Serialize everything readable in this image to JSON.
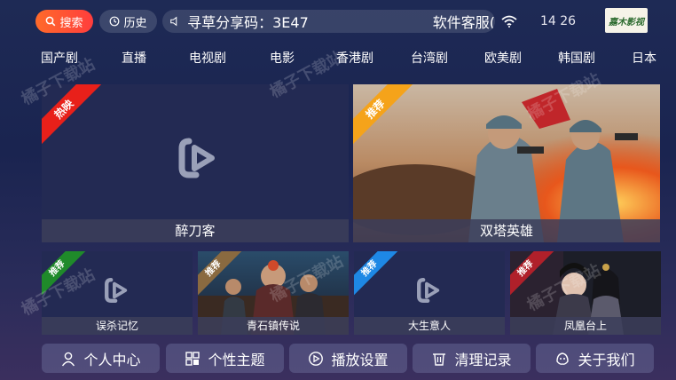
{
  "topbar": {
    "search_label": "搜索",
    "history_label": "历史",
    "marquee_text_1": "寻草分享码：3E47",
    "marquee_text_2": "软件客服(",
    "time": "14 26",
    "logo_text": "嘉木影视"
  },
  "nav": {
    "items": [
      "国产剧",
      "直播",
      "电视剧",
      "电影",
      "香港剧",
      "台湾剧",
      "欧美剧",
      "韩国剧",
      "日本"
    ]
  },
  "cards": {
    "big": [
      {
        "title": "醉刀客",
        "badge": "热映",
        "badge_color": "#e8201a"
      },
      {
        "title": "双塔英雄",
        "badge": "推荐",
        "badge_color": "#f5a31a"
      }
    ],
    "small": [
      {
        "title": "误杀记忆",
        "badge": "推荐",
        "badge_color": "#1f8a2a"
      },
      {
        "title": "青石镇传说",
        "badge": "推荐",
        "badge_color": "#8a6a40"
      },
      {
        "title": "大生意人",
        "badge": "推荐",
        "badge_color": "#1e88e5"
      },
      {
        "title": "凤凰台上",
        "badge": "推荐",
        "badge_color": "#b0202a"
      }
    ]
  },
  "bottom": {
    "buttons": [
      "个人中心",
      "个性主题",
      "播放设置",
      "清理记录",
      "关于我们"
    ]
  },
  "watermark": "橘子下载站",
  "colors": {
    "accent": "#ff4a30",
    "background": "#1e2a55"
  }
}
